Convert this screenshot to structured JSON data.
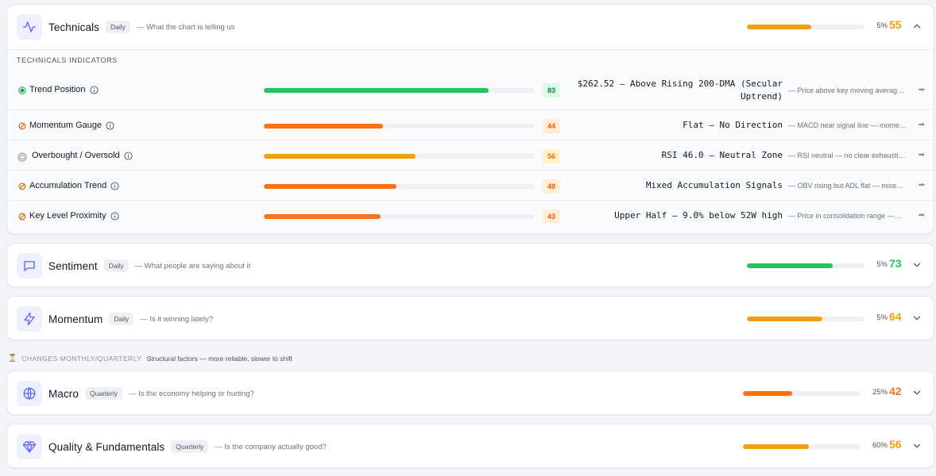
{
  "colors": {
    "green": "#22c55e",
    "amber": "#f59e0b",
    "orange": "#f97316",
    "icon_accent": "#6366f1"
  },
  "cards": {
    "technicals": {
      "icon": "activity-icon",
      "title": "Technicals",
      "badge": "Daily",
      "subtitle": "— What the chart is telling us",
      "weight": "5%",
      "score": "55",
      "score_fraction": 0.55,
      "expanded": true,
      "section_label": "TECHNICALS INDICATORS",
      "indicators": [
        {
          "status": "active-dot",
          "name": "Trend Position",
          "score": "83",
          "fraction": 0.83,
          "reading": "$262.52 — Above Rising 200-DMA (Secular Uptrend)",
          "note": "— Price above key moving averag…",
          "arrow": "➡"
        },
        {
          "status": "slash-circle",
          "name": "Momentum Gauge",
          "score": "44",
          "fraction": 0.44,
          "reading": "Flat — No Direction",
          "note": "— MACD near signal line — mome…",
          "arrow": "➡"
        },
        {
          "status": "neutral-ring",
          "name": "Overbought / Oversold",
          "score": "56",
          "fraction": 0.56,
          "reading": "RSI 46.0 — Neutral Zone",
          "note": "— RSI neutral — no clear exhausti…",
          "arrow": "➡"
        },
        {
          "status": "slash-circle",
          "name": "Accumulation Trend",
          "score": "49",
          "fraction": 0.49,
          "reading": "Mixed Accumulation Signals",
          "note": "— OBV rising but ADL flat — mixe…",
          "arrow": "➡"
        },
        {
          "status": "slash-circle",
          "name": "Key Level Proximity",
          "score": "43",
          "fraction": 0.43,
          "reading": "Upper Half — 9.0% below 52W high",
          "note": "— Price in consolidation range —…",
          "arrow": "➡"
        }
      ]
    },
    "sentiment": {
      "icon": "message-square-icon",
      "title": "Sentiment",
      "badge": "Daily",
      "subtitle": "— What people are saying about it",
      "weight": "5%",
      "score": "73",
      "score_fraction": 0.73
    },
    "momentum": {
      "icon": "lightning-icon",
      "title": "Momentum",
      "badge": "Daily",
      "subtitle": "— Is it winning lately?",
      "weight": "5%",
      "score": "64",
      "score_fraction": 0.64
    },
    "macro": {
      "icon": "globe-icon",
      "title": "Macro",
      "badge": "Quarterly",
      "subtitle": "— Is the economy helping or hurting?",
      "weight": "25%",
      "score": "42",
      "score_fraction": 0.42
    },
    "quality": {
      "icon": "gem-icon",
      "title": "Quality & Fundamentals",
      "badge": "Quarterly",
      "subtitle": "— Is the company actually good?",
      "weight": "60%",
      "score": "56",
      "score_fraction": 0.56
    }
  },
  "group_label": {
    "icon": "hourglass-icon",
    "title": "CHANGES MONTHLY/QUARTERLY",
    "description": "Structural factors — more reliable, slower to shift"
  }
}
